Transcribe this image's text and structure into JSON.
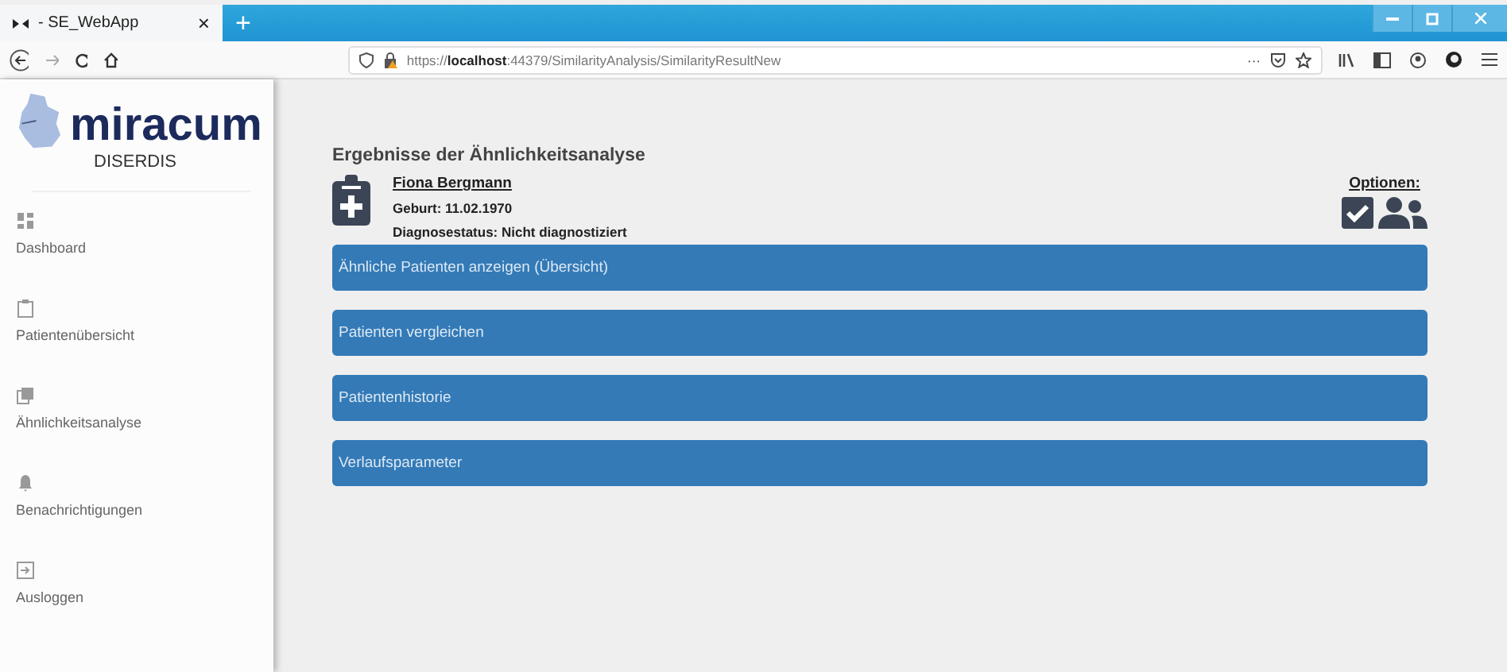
{
  "browser": {
    "tab_title": "- SE_WebApp",
    "tab_close": "×",
    "new_tab": "+",
    "url_scheme": "https://",
    "url_host": "localhost",
    "url_rest": ":44379/SimilarityAnalysis/SimilarityResultNew",
    "more": "···"
  },
  "sidebar": {
    "logo": "miracum",
    "subtitle": "DISERDIS",
    "items": [
      {
        "label": "Dashboard",
        "kind": "dashboard"
      },
      {
        "label": "Patientenübersicht",
        "kind": "clipboard"
      },
      {
        "label": "Ähnlichkeitsanalyse",
        "kind": "copy"
      },
      {
        "label": "Benachrichtigungen",
        "kind": "bell"
      },
      {
        "label": "Ausloggen",
        "kind": "logout"
      }
    ]
  },
  "main": {
    "title": "Ergebnisse der Ähnlichkeitsanalyse",
    "patient": {
      "name": "Fiona Bergmann",
      "birth": "Geburt: 11.02.1970",
      "status": "Diagnosestatus: Nicht diagnostiziert"
    },
    "options_label": "Optionen:",
    "sections": [
      {
        "label": "Ähnliche Patienten anzeigen (Übersicht)"
      },
      {
        "label": "Patienten vergleichen"
      },
      {
        "label": "Patientenhistorie"
      },
      {
        "label": "Verlaufsparameter"
      }
    ]
  }
}
